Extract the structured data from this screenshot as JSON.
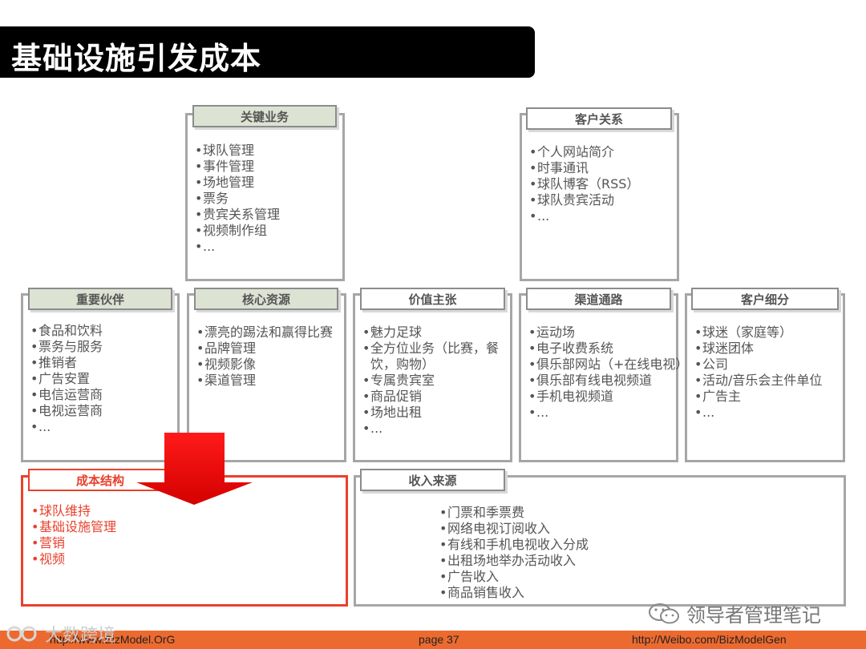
{
  "slide": {
    "title": "基础设施引发成本"
  },
  "blocks": {
    "key_activities": {
      "title": "关键业务",
      "items": [
        "球队管理",
        "事件管理",
        "场地管理",
        "票务",
        "贵宾关系管理",
        "视频制作组",
        "..."
      ]
    },
    "customer_relationships": {
      "title": "客户关系",
      "items": [
        "个人网站简介",
        "时事通讯",
        "球队博客（RSS）",
        "球队贵宾活动",
        "..."
      ]
    },
    "key_partners": {
      "title": "重要伙伴",
      "items": [
        "食品和饮料",
        "票务与服务",
        "推销者",
        "广告安置",
        "电信运营商",
        "电视运营商",
        "..."
      ]
    },
    "key_resources": {
      "title": "核心资源",
      "items": [
        "漂亮的踢法和赢得比赛",
        "品牌管理",
        "视频影像",
        "渠道管理"
      ]
    },
    "value_propositions": {
      "title": "价值主张",
      "items": [
        "魅力足球",
        "全方位业务（比赛，餐",
        "专属贵宾室",
        "商品促销",
        "场地出租",
        "..."
      ],
      "wrap_line": "饮，购物）"
    },
    "channels": {
      "title": "渠道通路",
      "items": [
        "运动场",
        "电子收费系统",
        "俱乐部网站（+在线电视）",
        "俱乐部有线电视频道",
        "手机电视频道",
        "..."
      ]
    },
    "customer_segments": {
      "title": "客户细分",
      "items": [
        "球迷（家庭等）",
        "球迷团体",
        "公司",
        "活动/音乐会主件单位",
        "广告主",
        "..."
      ]
    },
    "cost_structure": {
      "title": "成本结构",
      "items": [
        "球队维持",
        "基础设施管理",
        "营销",
        "视频"
      ]
    },
    "revenue_streams": {
      "title": "收入来源",
      "items": [
        "门票和季票费",
        "网络电视订阅收入",
        "有线和手机电视收入分成",
        "出租场地举办活动收入",
        "广告收入",
        "商品销售收入"
      ]
    }
  },
  "footer": {
    "left": "http://www.BizModel.OrG",
    "center": "page 37",
    "right": "http://Weibo.com/BizModelGen"
  },
  "watermarks": {
    "right": "领导者管理笔记",
    "left": "大数跨境"
  },
  "colors": {
    "accent_red": "#e8412c",
    "footer_orange": "#ec6a2f",
    "tag_green": "#dde3d3",
    "border_gray": "#a6a6a6"
  }
}
